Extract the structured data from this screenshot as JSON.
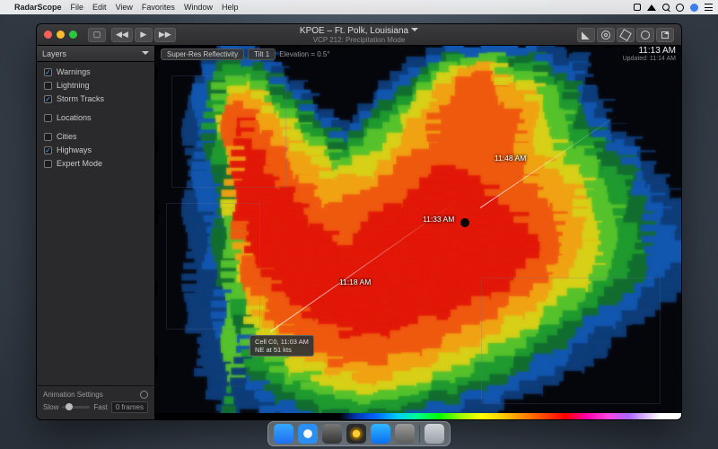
{
  "menubar": {
    "app": "RadarScope",
    "items": [
      "File",
      "Edit",
      "View",
      "Favorites",
      "Window",
      "Help"
    ]
  },
  "window": {
    "station": "KPOE – Ft. Polk, Louisiana",
    "mode": "VCP 212: Precipitation Mode"
  },
  "toolbar": {
    "product": "Super-Res Reflectivity",
    "tilt": "Tilt 1",
    "elevation": "Elevation = 0.5°"
  },
  "time": {
    "main": "11:13 AM",
    "updated": "Updated: 11:14 AM"
  },
  "sidebar": {
    "header": "Layers",
    "groups": [
      [
        {
          "label": "Warnings",
          "checked": true
        },
        {
          "label": "Lightning",
          "checked": false
        },
        {
          "label": "Storm Tracks",
          "checked": true
        }
      ],
      [
        {
          "label": "Locations",
          "checked": false
        }
      ],
      [
        {
          "label": "Cities",
          "checked": false
        },
        {
          "label": "Highways",
          "checked": true
        },
        {
          "label": "Expert Mode",
          "checked": false
        }
      ]
    ],
    "animation": {
      "title": "Animation Settings",
      "slow": "Slow",
      "fast": "Fast",
      "frames": "0 frames"
    }
  },
  "storm_track": {
    "points": [
      "11:48 AM",
      "11:33 AM",
      "11:18 AM"
    ],
    "cell": {
      "title": "Cell C0, 11:03 AM",
      "sub": "NE at 51 kts"
    }
  },
  "dock": {
    "apps": [
      "finder",
      "safari",
      "rocket",
      "radar",
      "store",
      "prefs"
    ],
    "trash": "Trash"
  },
  "radar_palette": {
    "clear": "#06070c",
    "low1": "#0e3c7a",
    "low2": "#1257b0",
    "mid1": "#126e2e",
    "mid2": "#1f9a2f",
    "mid3": "#56c22b",
    "high1": "#d8d017",
    "high2": "#f0a313",
    "high3": "#ef5a0f",
    "high4": "#e11708"
  },
  "radar_field": {
    "cols": 54,
    "rows": 40,
    "comment": "values 0-9 map to radar_palette clear..high4; rough transcription of on-screen echo pattern",
    "grid": [
      "000000122110000000000000000011222222222111000000000000",
      "000001233221000000000000001123455554333221110000000000",
      "000002344432100000000000012345677765544332210000000000",
      "000012455543210000000000123456788876655443210000000000",
      "000023566654321000000001234567788887766554321000000000",
      "000123577765432100000012345677888887776654321000000000",
      "000124588776543210000123456678888888777654432100000000",
      "000124688877654321001234566788888888877655432100000000",
      "000124689887765432112345567788888888877655432210000000",
      "000123589888766543223455677788888888877655443221000000",
      "000123489988776654334556677788888888877665544322100000",
      "000123479998877665445566778888888888877666554332210000",
      "000122479998887766556667788888888888887766555433221000",
      "000122379998887776666677888899998888887776655443321000",
      "000122379999888777777778888999999888887777665544321100",
      "000122379999998877777888889999999988888777765544322110",
      "000122369999998887788888899999999998888877766544332111",
      "000122369999999888888889999999999999888887766554332211",
      "000112359999999988888899999999999999988887776554332211",
      "000112358999999998888999999999999999998887776554432221",
      "000112358999999999889999999999999999999887776554432221",
      "000112357999999999999999999999999999999887776554432222",
      "000112357899999999999999999999999999999887766554432222",
      "000112356899999999999999999999999999998877766554332221",
      "000111356889999999999999999999999999988877665544332211",
      "000111355888999999999999999999999999888776665443322111",
      "000111255788899999999999999999999988887766554433221110",
      "000111254778889999999999999999998888777665544332211100",
      "000111254678888999999999999999888887776655443222111000",
      "000111253667888889999999999888888777666554332221110000",
      "000111253566788888899999888888877776655443322111000000",
      "000011152556778888888888888887777666554433221110000000",
      "000011152455677788888888888777766655544332211100000000",
      "000011151445566777888888777776665554433222111000000000",
      "000011151344556667777777776666555444332221110000000000",
      "000001151234455566667777666655544433222111000000000000",
      "000001141223344555666666655544433322211100000000000000",
      "000001141122334444555555544433322221110000000000000000",
      "000000131112223334444444433322221111000000000000000000",
      "000000121011122223333333322221111000000000000000000000"
    ]
  }
}
